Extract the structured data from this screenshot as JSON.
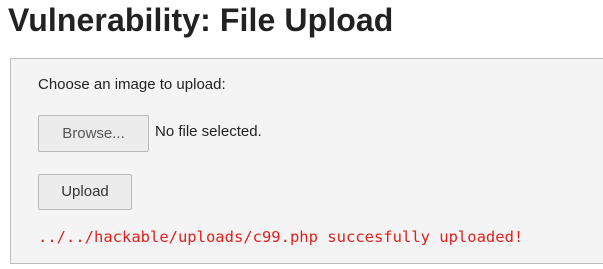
{
  "page": {
    "title": "Vulnerability: File Upload"
  },
  "upload_form": {
    "prompt": "Choose an image to upload:",
    "browse_label": "Browse...",
    "file_status": "No file selected.",
    "upload_label": "Upload",
    "result_message": "../../hackable/uploads/c99.php succesfully uploaded!"
  },
  "colors": {
    "error_text": "#e0201c",
    "panel_background": "#f4f4f4"
  }
}
